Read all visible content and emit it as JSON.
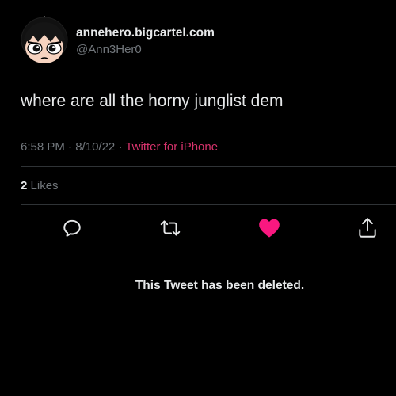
{
  "author": {
    "display_name": "annehero.bigcartel.com",
    "handle": "@Ann3Her0",
    "avatar_icon": "powerpuff-girl-avatar"
  },
  "tweet": {
    "text": "where are all the horny junglist dem",
    "time": "6:58 PM",
    "date": "8/10/22",
    "separator": "·",
    "source": "Twitter for iPhone"
  },
  "stats": {
    "likes_count": "2",
    "likes_label": "Likes"
  },
  "actions": {
    "reply_icon": "reply-icon",
    "retweet_icon": "retweet-icon",
    "like_icon": "heart-icon",
    "share_icon": "share-icon",
    "liked": true
  },
  "deleted_notice": "This Tweet has been deleted.",
  "colors": {
    "background": "#000000",
    "primary_text": "#e7e9ea",
    "secondary_text": "#71767b",
    "link": "#d6336c",
    "like_active": "#f91880",
    "divider": "#2f3336"
  }
}
